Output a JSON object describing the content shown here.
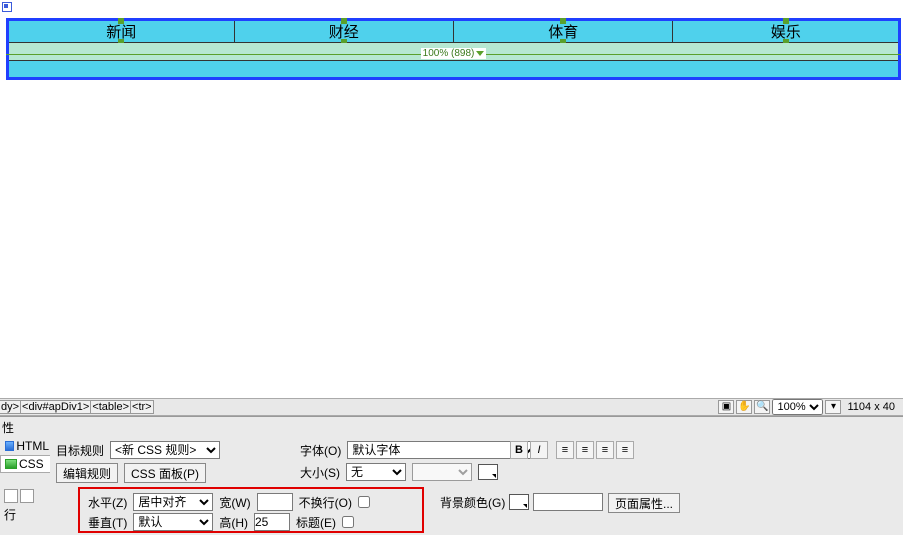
{
  "nav": {
    "cells": [
      "新闻",
      "财经",
      "体育",
      "娱乐"
    ]
  },
  "widthbar": "100% (898)",
  "breadcrumb": [
    "dy>",
    "<div#apDiv1>",
    "<table>",
    "<tr>"
  ],
  "zoom": "100%",
  "dimensions": "1104 x 40",
  "props_title": "性",
  "tabs": {
    "html": "HTML",
    "css": "CSS"
  },
  "labels": {
    "target_rule": "目标规则",
    "target_rule_val": "<新 CSS 规则>",
    "edit_rule": "编辑规则",
    "css_panel": "CSS 面板(P)",
    "font": "字体(O)",
    "font_val": "默认字体",
    "size": "大小(S)",
    "size_val": "无",
    "horiz": "水平(Z)",
    "horiz_val": "居中对齐",
    "vert": "垂直(T)",
    "vert_val": "默认",
    "width": "宽(W)",
    "width_val": "",
    "height": "高(H)",
    "height_val": "25",
    "nowrap": "不换行(O)",
    "header": "标题(E)",
    "bg": "背景颜色(G)",
    "page_props": "页面属性...",
    "row": "行"
  },
  "fmt_buttons": [
    "B",
    "I"
  ]
}
